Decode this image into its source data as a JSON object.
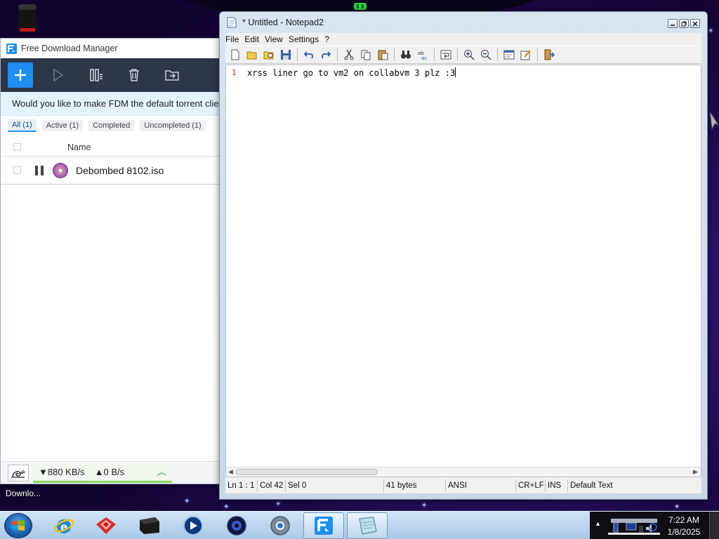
{
  "fdm": {
    "title": "Free Download Manager",
    "banner": "Would you like to make FDM the default torrent client?",
    "tabs": [
      {
        "label": "All (1)",
        "active": true
      },
      {
        "label": "Active (1)",
        "active": false
      },
      {
        "label": "Completed",
        "active": false
      },
      {
        "label": "Uncompleted (1)",
        "active": false
      }
    ],
    "column_name": "Name",
    "downloads": [
      {
        "name": "Debombed 8102.iso",
        "state": "paused"
      }
    ],
    "download_speed": "▼880 KB/s",
    "upload_speed": "▲0 B/s",
    "toolbar_icons": [
      "add-icon",
      "resume-icon",
      "pause-all-icon",
      "delete-icon",
      "move-icon"
    ],
    "accent_color": "#1e8ff0"
  },
  "notepad": {
    "title": "* Untitled - Notepad2",
    "menu": [
      "File",
      "Edit",
      "View",
      "Settings",
      "?"
    ],
    "line_number": "1",
    "content": "xrss liner go to vm2 on collabvm 3 plz :3",
    "status": {
      "position": "Ln 1 : 1",
      "column": "Col 42",
      "selection": "Sel 0",
      "size": "41 bytes",
      "encoding": "ANSI",
      "line_ending": "CR+LF",
      "mode": "INS",
      "scheme": "Default Text"
    }
  },
  "desktop": {
    "taskbar_label": "Downlo..."
  },
  "taskbar": {
    "apps": [
      "internet-explorer",
      "flowers-app",
      "terminal-app",
      "media-player",
      "browser-app",
      "chrome-app",
      "free-download-manager",
      "notepad2"
    ],
    "clock_time": "7:22 AM",
    "clock_date": "1/8/2025"
  }
}
